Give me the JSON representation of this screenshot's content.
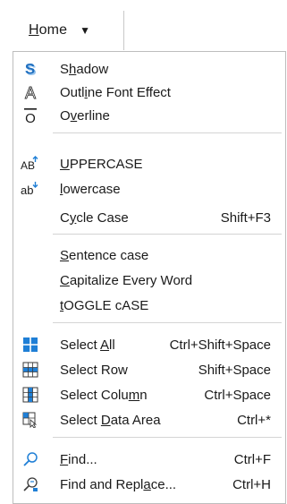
{
  "toolbar": {
    "home_label": "Home",
    "home_mnemonic": "H",
    "home_rest": "ome",
    "dropdown_caret": "▼"
  },
  "menu": {
    "items": [
      {
        "pre": "S",
        "mn": "h",
        "post": "adow",
        "shortcut": "",
        "icon": "shadow-icon"
      },
      {
        "pre": "Outl",
        "mn": "i",
        "post": "ne Font Effect",
        "shortcut": "",
        "icon": "outline-font-icon"
      },
      {
        "pre": "O",
        "mn": "v",
        "post": "erline",
        "shortcut": "",
        "icon": "overline-icon"
      },
      {
        "pre": "",
        "mn": "U",
        "post": "PPERCASE",
        "shortcut": "",
        "icon": "uppercase-icon"
      },
      {
        "pre": "",
        "mn": "l",
        "post": "owercase",
        "shortcut": "",
        "icon": "lowercase-icon"
      },
      {
        "pre": "C",
        "mn": "y",
        "post": "cle Case",
        "shortcut": "Shift+F3",
        "icon": ""
      },
      {
        "pre": "",
        "mn": "S",
        "post": "entence case",
        "shortcut": "",
        "icon": ""
      },
      {
        "pre": "",
        "mn": "C",
        "post": "apitalize Every Word",
        "shortcut": "",
        "icon": ""
      },
      {
        "pre": "",
        "mn": "t",
        "post": "OGGLE cASE",
        "shortcut": "",
        "icon": ""
      },
      {
        "pre": "Select ",
        "mn": "A",
        "post": "ll",
        "shortcut": "Ctrl+Shift+Space",
        "icon": "select-all-icon"
      },
      {
        "pre": "Select Row",
        "mn": "",
        "post": "",
        "shortcut": "Shift+Space",
        "icon": "select-row-icon"
      },
      {
        "pre": "Select Colu",
        "mn": "m",
        "post": "n",
        "shortcut": "Ctrl+Space",
        "icon": "select-column-icon"
      },
      {
        "pre": "Select ",
        "mn": "D",
        "post": "ata Area",
        "shortcut": "Ctrl+*",
        "icon": "select-data-area-icon"
      },
      {
        "pre": "",
        "mn": "F",
        "post": "ind...",
        "shortcut": "Ctrl+F",
        "icon": "find-icon"
      },
      {
        "pre": "Find and Repl",
        "mn": "a",
        "post": "ce...",
        "shortcut": "Ctrl+H",
        "icon": "find-replace-icon"
      }
    ]
  },
  "icon_glyphs": {
    "outline": "A",
    "overline": "O",
    "uppercase": "AB",
    "lowercase": "ab"
  },
  "colors": {
    "icon_blue": "#1f7fd6",
    "icon_dark": "#3a3a3a",
    "menu_border": "#bdbdbd",
    "separator": "#d4d4d4"
  }
}
